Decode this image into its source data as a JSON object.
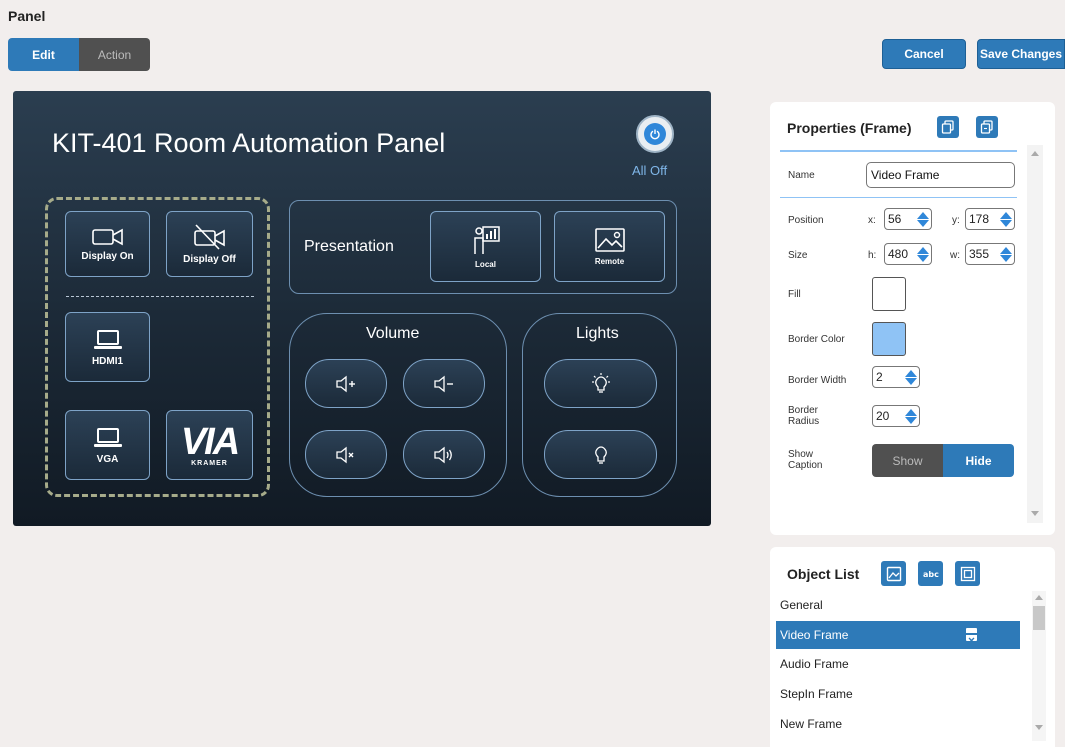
{
  "page": {
    "title": "Panel"
  },
  "mode_toggle": {
    "edit_label": "Edit",
    "action_label": "Action"
  },
  "header_actions": {
    "cancel_label": "Cancel",
    "save_label": "Save Changes"
  },
  "panel": {
    "title": "KIT-401 Room Automation Panel",
    "all_off_label": "All Off",
    "video": {
      "display_on_label": "Display On",
      "display_off_label": "Display Off",
      "hdmi_label": "HDMI1",
      "vga_label": "VGA",
      "logo_text": "VIA",
      "logo_sub": "KRAMER"
    },
    "presentation": {
      "label": "Presentation",
      "local_label": "Local",
      "remote_label": "Remote"
    },
    "volume": {
      "label": "Volume"
    },
    "lights": {
      "label": "Lights"
    }
  },
  "properties": {
    "title": "Properties (Frame)",
    "name_label": "Name",
    "name_value": "Video Frame",
    "position_label": "Position",
    "x_label": "x:",
    "x_value": "56",
    "y_label": "y:",
    "y_value": "178",
    "size_label": "Size",
    "h_label": "h:",
    "h_value": "480",
    "w_label": "w:",
    "w_value": "355",
    "fill_label": "Fill",
    "fill_color": "#ffffff",
    "border_color_label": "Border Color",
    "border_color_value": "#8fc3f5",
    "border_width_label": "Border Width",
    "border_width_value": "2",
    "border_radius_label": "Border Radius",
    "border_radius_value": "20",
    "show_caption_label": "Show Caption",
    "show_label": "Show",
    "hide_label": "Hide"
  },
  "object_list": {
    "title": "Object List",
    "items": [
      {
        "label": "General",
        "selected": false
      },
      {
        "label": "Video Frame",
        "selected": true
      },
      {
        "label": "Audio Frame",
        "selected": false
      },
      {
        "label": "StepIn Frame",
        "selected": false
      },
      {
        "label": "New Frame",
        "selected": false
      }
    ]
  },
  "colors": {
    "accent": "#2e7ab8",
    "panel_bg": "#1a2734",
    "frame_border": "#7ea3c7",
    "dashed": "#a6ab8a"
  }
}
